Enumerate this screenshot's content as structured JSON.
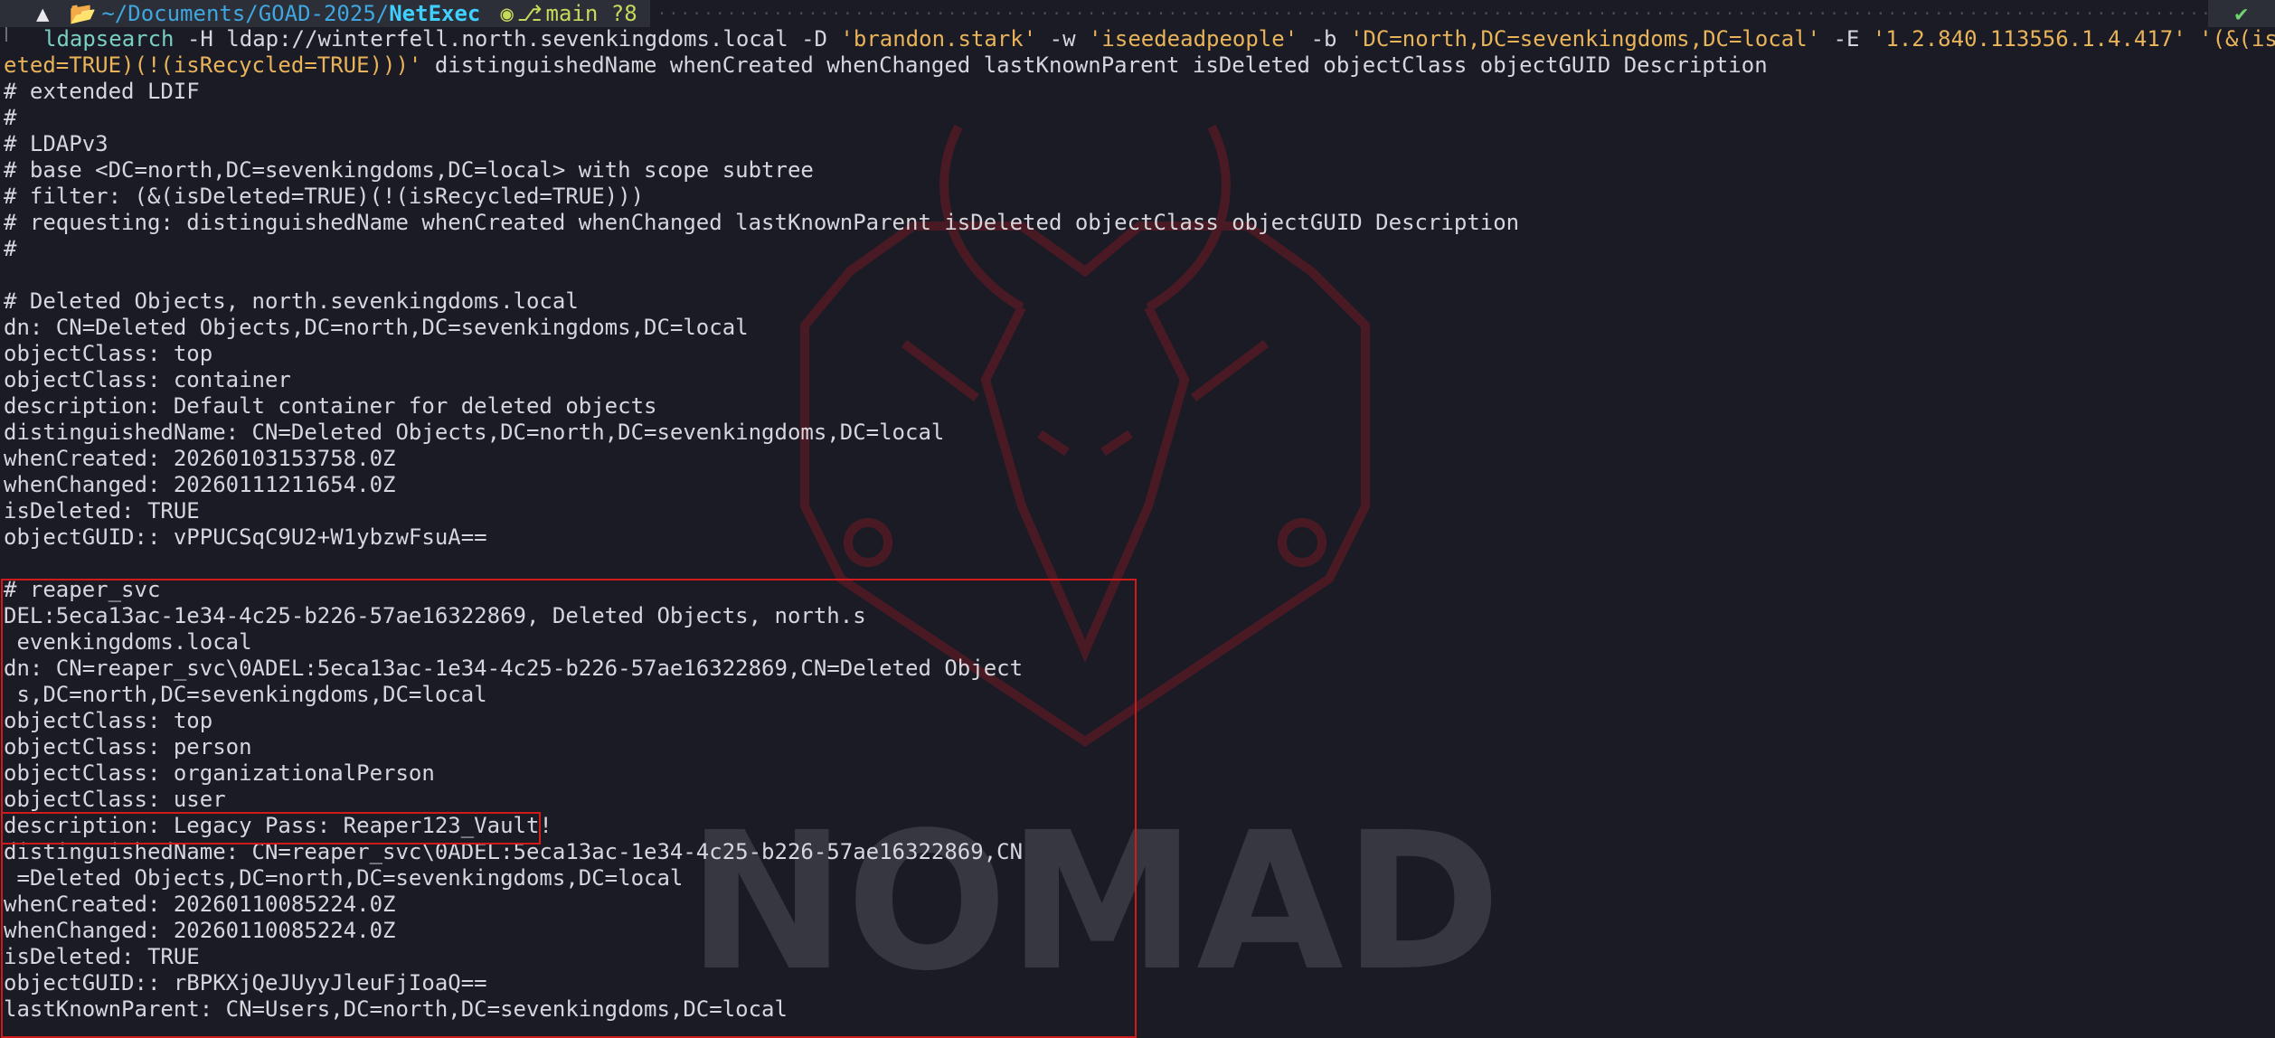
{
  "prompt": {
    "path_prefix": "~/Documents/GOAD-2025/",
    "path_current": "NetExec",
    "branch": "main ?8",
    "status_ok": "✔"
  },
  "icons": [
    "arch-logo-icon",
    "folder-icon",
    "github-icon",
    "branch-icon",
    "checkmark-icon"
  ],
  "command": {
    "name": "ldapsearch",
    "part1": " -H ldap://winterfell.north.sevenkingdoms.local -D ",
    "user": "'brandon.stark'",
    "part2": " -w ",
    "password": "'iseedeadpeople'",
    "part3": " -b ",
    "base": "'DC=north,DC=sevenkingdoms,DC=local'",
    "part4": " -E ",
    "control": "'1.2.840.113556.1.4.417'",
    "filter_a": " '(&(isDel",
    "filter_b": "eted=TRUE)(!(isRecycled=TRUE)))'",
    "attrs": " distinguishedName whenCreated whenChanged lastKnownParent isDeleted objectClass objectGUID Description"
  },
  "output": [
    "# extended LDIF",
    "#",
    "# LDAPv3",
    "# base <DC=north,DC=sevenkingdoms,DC=local> with scope subtree",
    "# filter: (&(isDeleted=TRUE)(!(isRecycled=TRUE)))",
    "# requesting: distinguishedName whenCreated whenChanged lastKnownParent isDeleted objectClass objectGUID Description",
    "#",
    "",
    "# Deleted Objects, north.sevenkingdoms.local",
    "dn: CN=Deleted Objects,DC=north,DC=sevenkingdoms,DC=local",
    "objectClass: top",
    "objectClass: container",
    "description: Default container for deleted objects",
    "distinguishedName: CN=Deleted Objects,DC=north,DC=sevenkingdoms,DC=local",
    "whenCreated: 20260103153758.0Z",
    "whenChanged: 20260111211654.0Z",
    "isDeleted: TRUE",
    "objectGUID:: vPPUCSqC9U2+W1ybzwFsuA==",
    "",
    "# reaper_svc",
    "DEL:5eca13ac-1e34-4c25-b226-57ae16322869, Deleted Objects, north.s",
    " evenkingdoms.local",
    "dn: CN=reaper_svc\\0ADEL:5eca13ac-1e34-4c25-b226-57ae16322869,CN=Deleted Object",
    " s,DC=north,DC=sevenkingdoms,DC=local",
    "objectClass: top",
    "objectClass: person",
    "objectClass: organizationalPerson",
    "objectClass: user",
    "description: Legacy Pass: Reaper123_Vault!",
    "distinguishedName: CN=reaper_svc\\0ADEL:5eca13ac-1e34-4c25-b226-57ae16322869,CN",
    " =Deleted Objects,DC=north,DC=sevenkingdoms,DC=local",
    "whenCreated: 20260110085224.0Z",
    "whenChanged: 20260110085224.0Z",
    "isDeleted: TRUE",
    "objectGUID:: rBPKXjQeJUyyJleuFjIoaQ==",
    "lastKnownParent: CN=Users,DC=north,DC=sevenkingdoms,DC=local"
  ],
  "colors": {
    "background": "#1a1b24",
    "highlight": "#d11a1a",
    "command": "#7ad0c0",
    "string": "#e9b35a",
    "path": "#3fa7e0"
  }
}
